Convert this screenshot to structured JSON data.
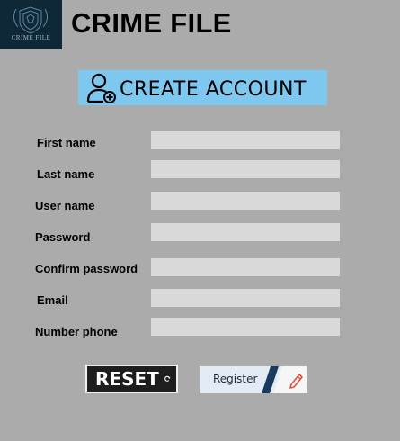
{
  "header": {
    "logo_text": "CRIME FILE",
    "title": "CRIME FILE"
  },
  "banner": {
    "text": "CREATE ACCOUNT",
    "icon": "add-user-icon"
  },
  "form": {
    "fields": [
      {
        "label": "First name",
        "value": ""
      },
      {
        "label": "Last name",
        "value": ""
      },
      {
        "label": "User name",
        "value": ""
      },
      {
        "label": "Password",
        "value": ""
      },
      {
        "label": "Confirm password",
        "value": ""
      },
      {
        "label": "Email",
        "value": ""
      },
      {
        "label": "Number phone",
        "value": ""
      }
    ]
  },
  "buttons": {
    "reset_label": "RESET",
    "reset_icon": "refresh-icon",
    "register_label": "Register",
    "register_icon": "pencil-icon"
  },
  "colors": {
    "background": "#ababab",
    "logo_bg": "#0f2838",
    "banner_bg": "#7ec8ef",
    "field_bg": "#d9d9d9",
    "register_accent": "#1a3a5e",
    "pencil": "#e0533f"
  }
}
